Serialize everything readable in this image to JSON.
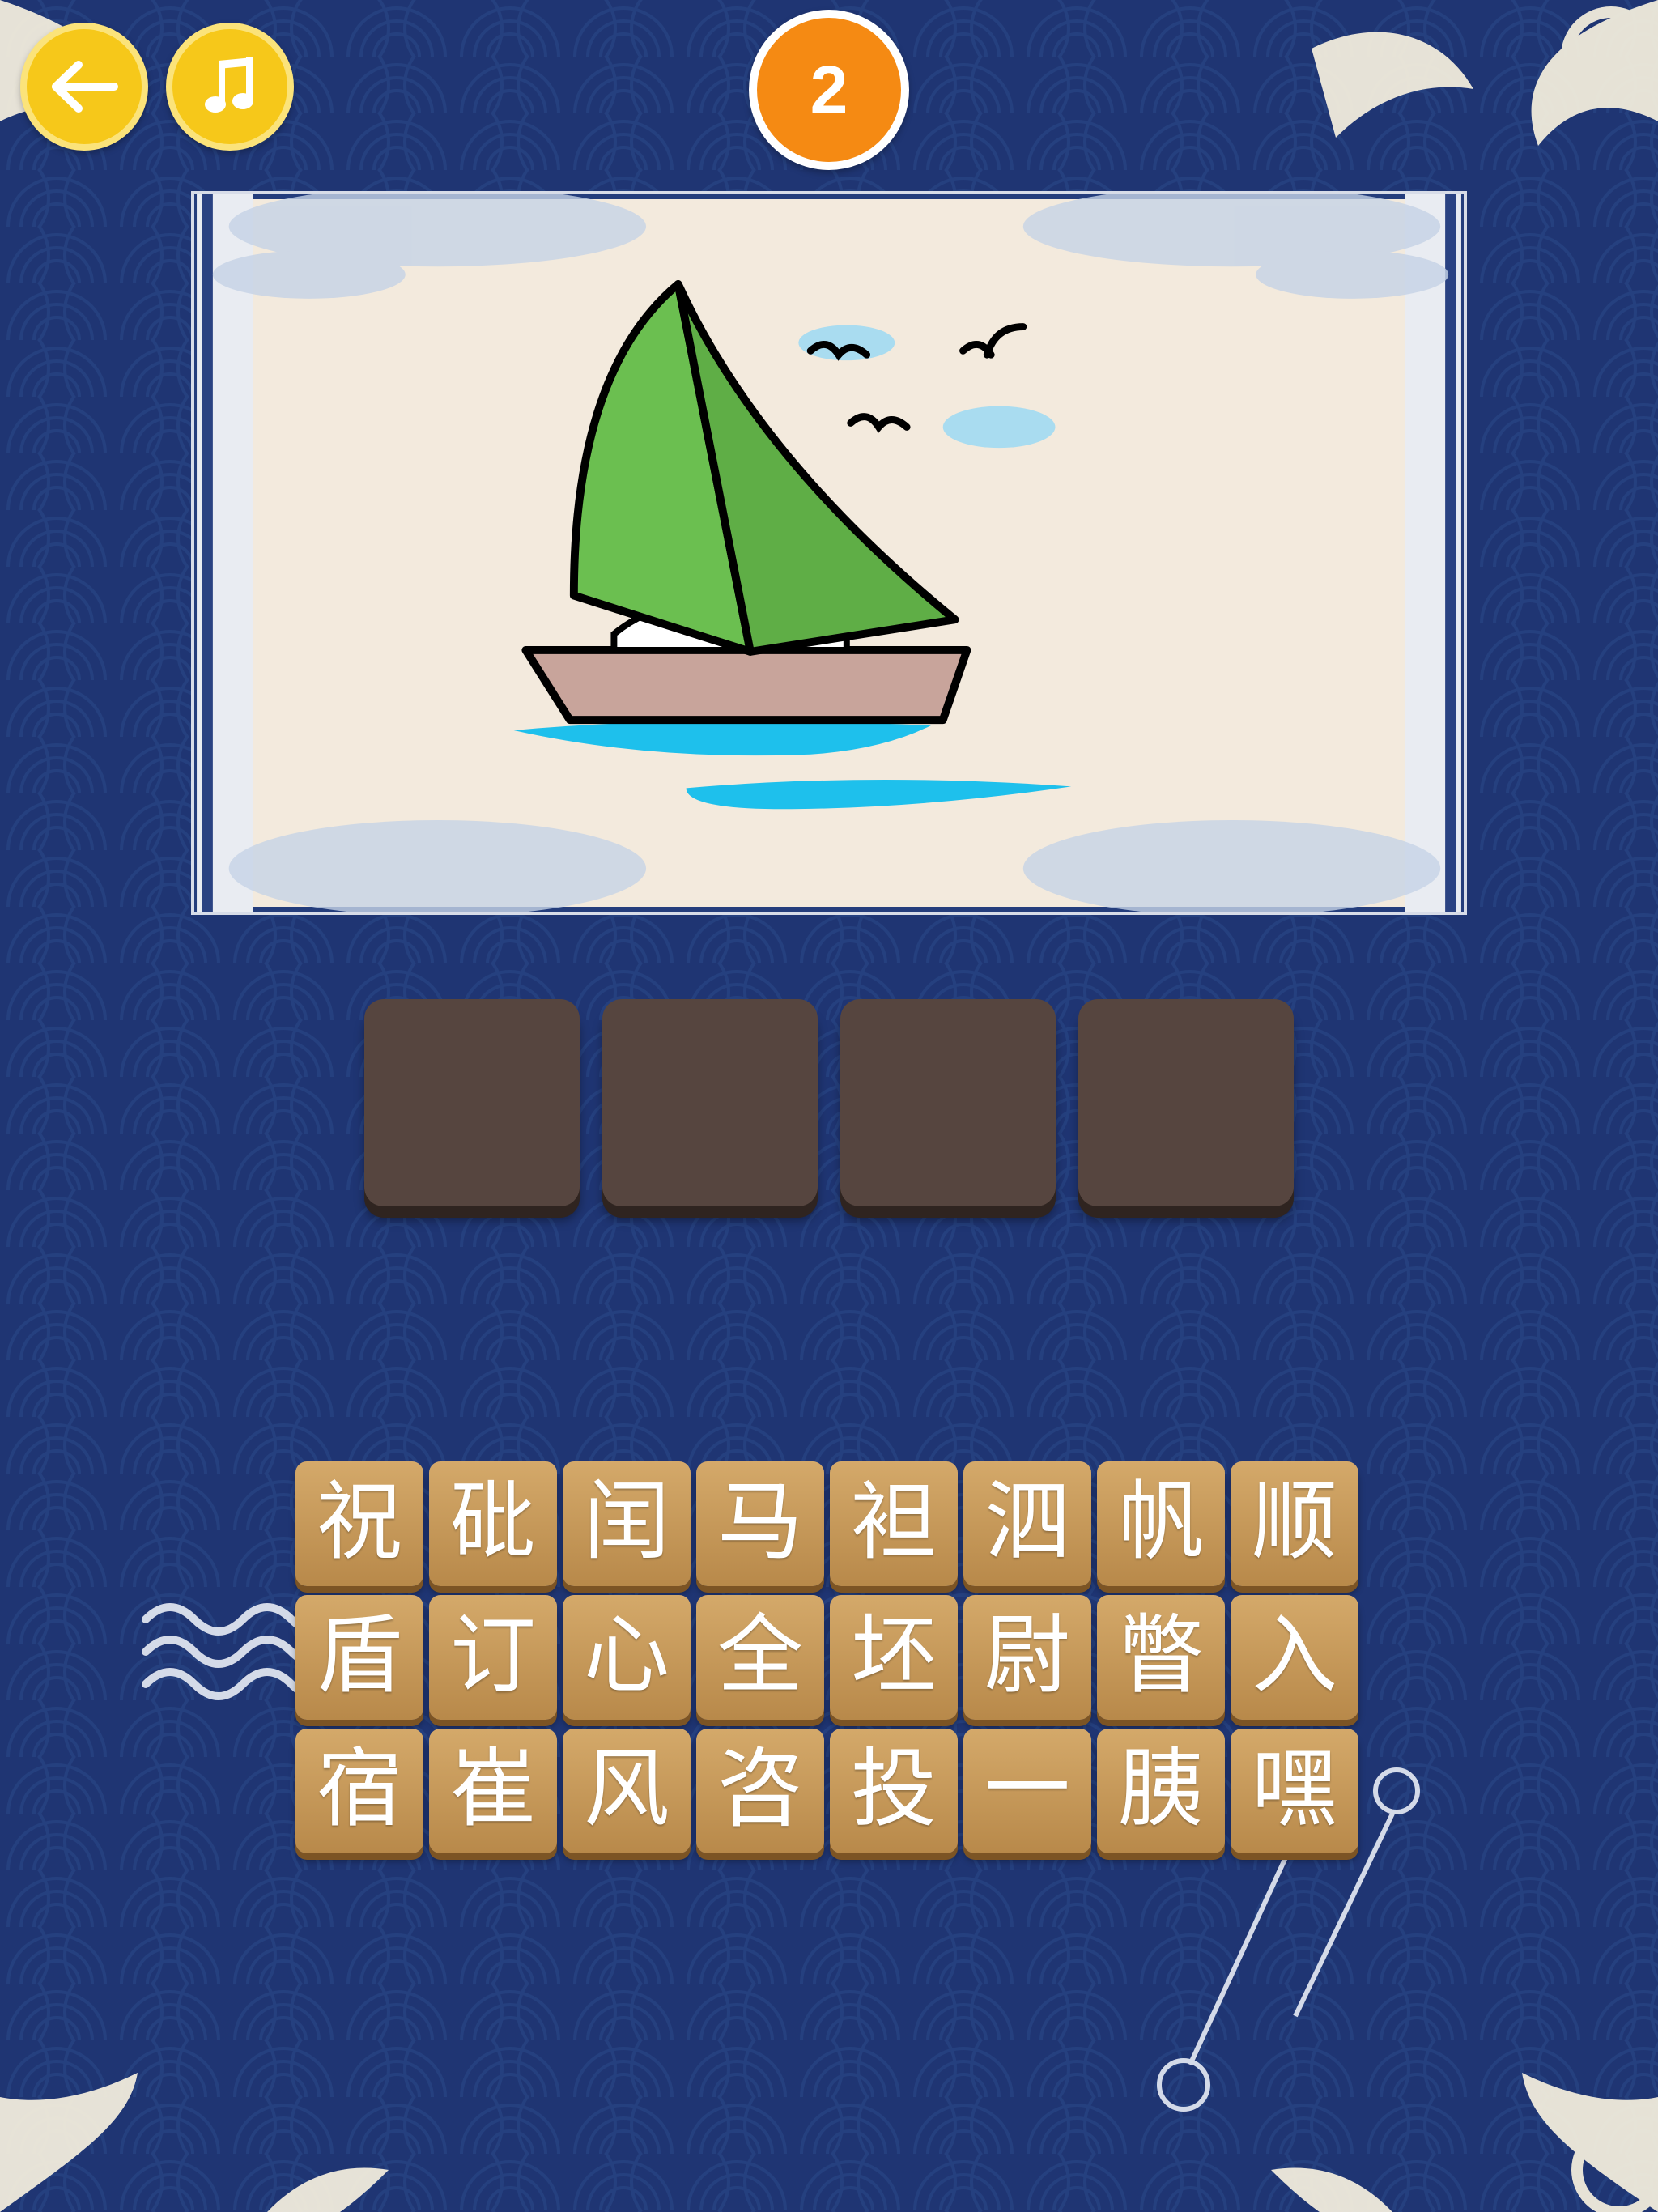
{
  "header": {
    "back_icon": "arrow-left-icon",
    "music_icon": "music-note-icon",
    "level": "2"
  },
  "puzzle": {
    "picture": "sailboat",
    "answer_slots": [
      "",
      "",
      "",
      ""
    ]
  },
  "char_grid": [
    [
      "祝",
      "砒",
      "闰",
      "马",
      "袒",
      "泗",
      "帆",
      "顺"
    ],
    [
      "盾",
      "订",
      "心",
      "全",
      "坯",
      "尉",
      "瞥",
      "入"
    ],
    [
      "宿",
      "崔",
      "风",
      "咨",
      "投",
      "一",
      "胰",
      "嘿"
    ]
  ],
  "colors": {
    "background": "#1f3573",
    "button_yellow": "#f6c81a",
    "level_orange": "#f58a13",
    "slot_brown": "#56453f",
    "tile_gold": "#c99a58"
  }
}
